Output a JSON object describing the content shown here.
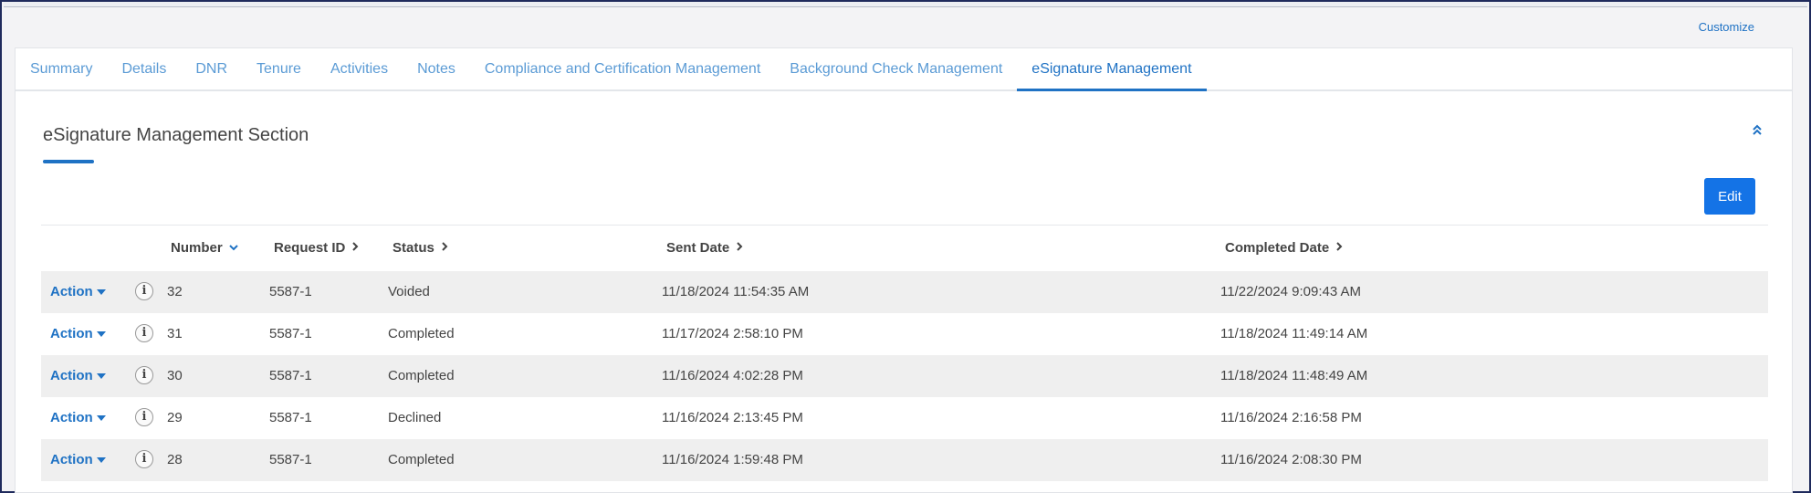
{
  "header": {
    "customize_label": "Customize"
  },
  "tabs": [
    {
      "label": "Summary"
    },
    {
      "label": "Details"
    },
    {
      "label": "DNR"
    },
    {
      "label": "Tenure"
    },
    {
      "label": "Activities"
    },
    {
      "label": "Notes"
    },
    {
      "label": "Compliance and Certification Management"
    },
    {
      "label": "Background Check Management"
    },
    {
      "label": "eSignature Management",
      "active": true
    }
  ],
  "section": {
    "title": "eSignature Management Section",
    "edit_label": "Edit",
    "collapse_icon": "double-chevron-up-icon"
  },
  "table": {
    "columns": {
      "number": "Number",
      "request_id": "Request ID",
      "status": "Status",
      "sent_date": "Sent Date",
      "completed_date": "Completed Date"
    },
    "action_label": "Action",
    "info_glyph": "i",
    "rows": [
      {
        "number": "32",
        "request_id": "5587-1",
        "status": "Voided",
        "sent_date": "11/18/2024 11:54:35 AM",
        "completed_date": "11/22/2024 9:09:43 AM"
      },
      {
        "number": "31",
        "request_id": "5587-1",
        "status": "Completed",
        "sent_date": "11/17/2024 2:58:10 PM",
        "completed_date": "11/18/2024 11:49:14 AM"
      },
      {
        "number": "30",
        "request_id": "5587-1",
        "status": "Completed",
        "sent_date": "11/16/2024 4:02:28 PM",
        "completed_date": "11/18/2024 11:48:49 AM"
      },
      {
        "number": "29",
        "request_id": "5587-1",
        "status": "Declined",
        "sent_date": "11/16/2024 2:13:45 PM",
        "completed_date": "11/16/2024 2:16:58 PM"
      },
      {
        "number": "28",
        "request_id": "5587-1",
        "status": "Completed",
        "sent_date": "11/16/2024 1:59:48 PM",
        "completed_date": "11/16/2024 2:08:30 PM"
      }
    ]
  },
  "colors": {
    "accent": "#1f72c4",
    "button": "#1473e6",
    "stripe": "#efefef"
  }
}
